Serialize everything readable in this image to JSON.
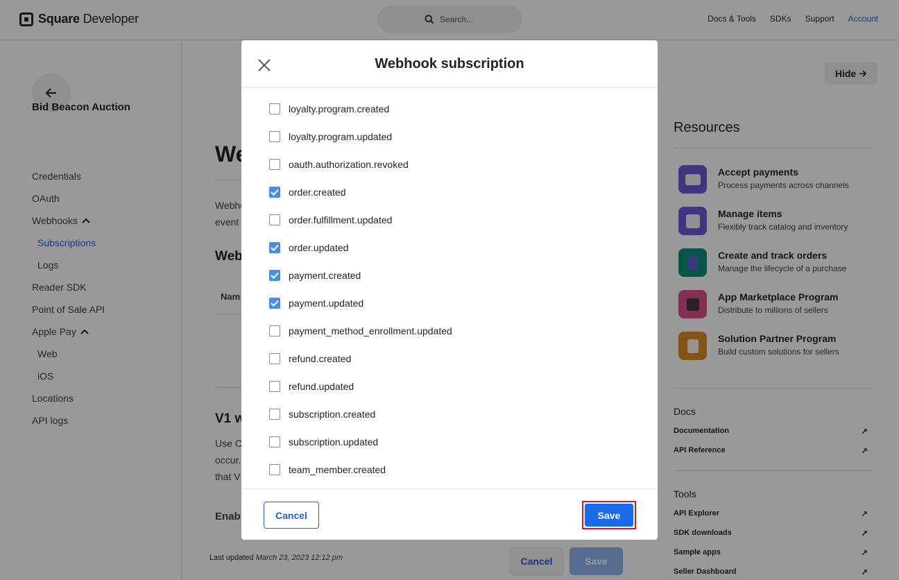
{
  "header": {
    "logo_bold": "Square",
    "logo_rest": " Developer",
    "search_placeholder": "Search...",
    "nav": [
      "Docs & Tools",
      "SDKs",
      "Support",
      "Account"
    ]
  },
  "sidebar": {
    "app_name": "Bid Beacon Auction",
    "items": [
      {
        "label": "Credentials"
      },
      {
        "label": "OAuth"
      },
      {
        "label": "Webhooks"
      },
      {
        "label": "Subscriptions"
      },
      {
        "label": "Logs"
      },
      {
        "label": "Reader SDK"
      },
      {
        "label": "Point of Sale API"
      },
      {
        "label": "Apple Pay"
      },
      {
        "label": "Web"
      },
      {
        "label": "iOS"
      },
      {
        "label": "Locations"
      },
      {
        "label": "API logs"
      }
    ]
  },
  "main": {
    "title_partial": "We",
    "text_1": "Webho",
    "text_2": "event",
    "h2_partial": "Web",
    "table_col_partial": "Nam",
    "v1_partial": "V1 w",
    "v1_text_1": "Use C",
    "v1_text_2": "occur.",
    "v1_text_3": "that V",
    "enable_partial": "Enab",
    "last_updated_label": "Last updated",
    "last_updated_value": "March 23, 2023 12:12 pm",
    "cancel_label": "Cancel",
    "save_label": "Save"
  },
  "right": {
    "hide_label": "Hide",
    "resources_title": "Resources",
    "resources": [
      {
        "title": "Accept payments",
        "desc": "Process payments across channels",
        "color": "#6b5bd6"
      },
      {
        "title": "Manage items",
        "desc": "Flexibly track catalog and inventory",
        "color": "#6b5bd6"
      },
      {
        "title": "Create and track orders",
        "desc": "Manage the lifecycle of a purchase",
        "color": "#0f8a78"
      },
      {
        "title": "App Marketplace Program",
        "desc": "Distribute to millions of sellers",
        "color": "#d94f8a"
      },
      {
        "title": "Solution Partner Program",
        "desc": "Build custom solutions for sellers",
        "color": "#d98a2a"
      }
    ],
    "docs_title": "Docs",
    "docs_links": [
      "Documentation",
      "API Reference"
    ],
    "tools_title": "Tools",
    "tools_links": [
      "API Explorer",
      "SDK downloads",
      "Sample apps",
      "Seller Dashboard"
    ]
  },
  "modal": {
    "title": "Webhook subscription",
    "events": [
      {
        "label": "loyalty.program.created",
        "checked": false
      },
      {
        "label": "loyalty.program.updated",
        "checked": false
      },
      {
        "label": "oauth.authorization.revoked",
        "checked": false
      },
      {
        "label": "order.created",
        "checked": true
      },
      {
        "label": "order.fulfillment.updated",
        "checked": false
      },
      {
        "label": "order.updated",
        "checked": true
      },
      {
        "label": "payment.created",
        "checked": true
      },
      {
        "label": "payment.updated",
        "checked": true
      },
      {
        "label": "payment_method_enrollment.updated",
        "checked": false
      },
      {
        "label": "refund.created",
        "checked": false
      },
      {
        "label": "refund.updated",
        "checked": false
      },
      {
        "label": "subscription.created",
        "checked": false
      },
      {
        "label": "subscription.updated",
        "checked": false
      },
      {
        "label": "team_member.created",
        "checked": false
      }
    ],
    "cancel_label": "Cancel",
    "save_label": "Save",
    "colors": {
      "checkbox_checked": "#4a8ee0",
      "primary": "#1a6ae8",
      "highlight_outline": "#c21d2f"
    }
  }
}
